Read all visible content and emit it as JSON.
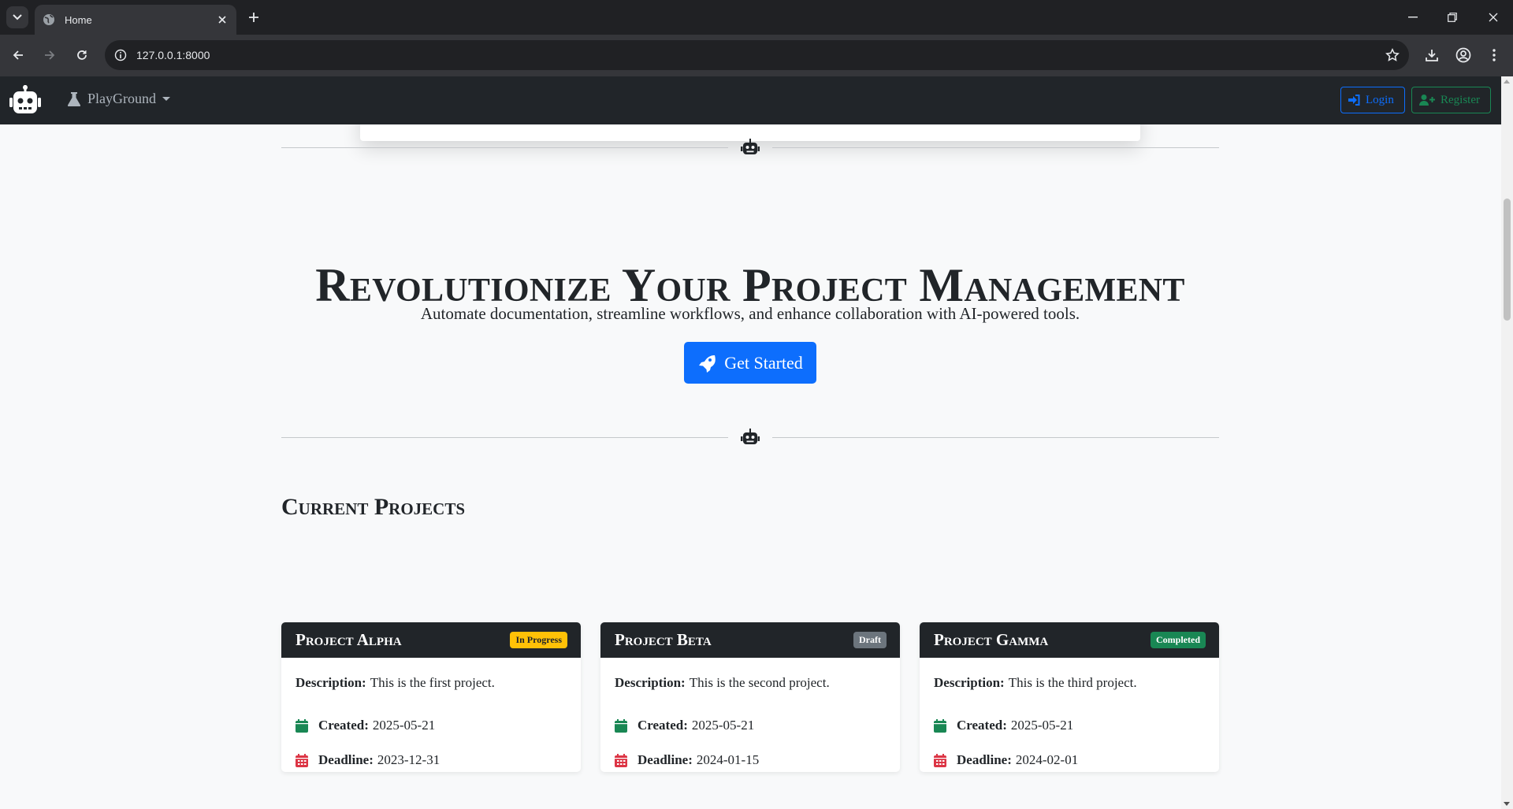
{
  "browser": {
    "tab_title": "Home",
    "url": "127.0.0.1:8000"
  },
  "navbar": {
    "menu_label": "PlayGround",
    "login_label": "Login",
    "register_label": "Register"
  },
  "hero": {
    "title": "Revolutionize Your Project Management",
    "subtitle": "Automate documentation, streamline workflows, and enhance collaboration with AI-powered tools.",
    "cta_label": "Get Started"
  },
  "projects": {
    "section_title": "Current Projects",
    "labels": {
      "description": "Description:",
      "created": "Created:",
      "deadline": "Deadline:"
    },
    "items": [
      {
        "name": "Project Alpha",
        "status": "In Progress",
        "description": "This is the first project.",
        "created": "2025-05-21",
        "deadline": "2023-12-31"
      },
      {
        "name": "Project Beta",
        "status": "Draft",
        "description": "This is the second project.",
        "created": "2025-05-21",
        "deadline": "2024-01-15"
      },
      {
        "name": "Project Gamma",
        "status": "Completed",
        "description": "This is the third project.",
        "created": "2025-05-21",
        "deadline": "2024-02-01"
      }
    ]
  },
  "colors": {
    "navbar_bg": "#212529",
    "primary": "#0d6efd",
    "success": "#198754",
    "warning": "#ffc107",
    "secondary": "#6c757d",
    "danger": "#dc3545"
  }
}
